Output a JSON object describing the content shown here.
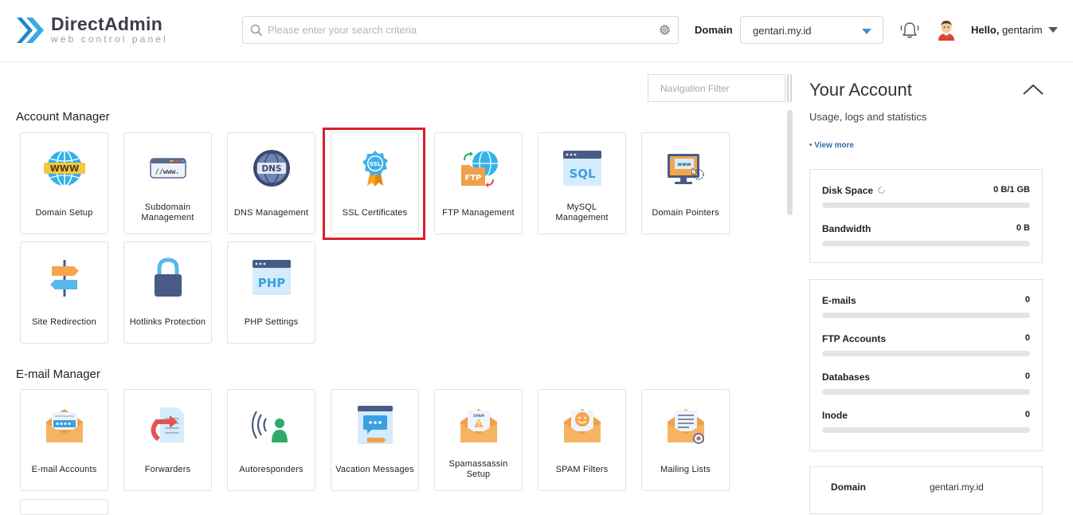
{
  "header": {
    "brand_title": "DirectAdmin",
    "brand_subtitle": "web control panel",
    "search_placeholder": "Please enter your search criteria",
    "domain_label": "Domain",
    "domain_value": "gentari.my.id",
    "greeting": "Hello,",
    "username": "gentarim"
  },
  "nav_filter": {
    "placeholder": "Navigation Filter"
  },
  "sections": [
    {
      "title": "Account Manager",
      "items": [
        {
          "label": "Domain Setup",
          "icon": "www-globe-icon"
        },
        {
          "label": "Subdomain Management",
          "icon": "subdomain-icon"
        },
        {
          "label": "DNS Management",
          "icon": "dns-globe-icon"
        },
        {
          "label": "SSL Certificates",
          "icon": "ssl-badge-icon"
        },
        {
          "label": "FTP Management",
          "icon": "ftp-folder-icon"
        },
        {
          "label": "MySQL Management",
          "icon": "sql-window-icon"
        },
        {
          "label": "Domain Pointers",
          "icon": "domain-pointer-monitor-icon"
        },
        {
          "label": "Site Redirection",
          "icon": "signpost-icon"
        },
        {
          "label": "Hotlinks Protection",
          "icon": "padlock-icon"
        },
        {
          "label": "PHP Settings",
          "icon": "php-window-icon"
        }
      ]
    },
    {
      "title": "E-mail Manager",
      "items": [
        {
          "label": "E-mail Accounts",
          "icon": "envelope-password-icon"
        },
        {
          "label": "Forwarders",
          "icon": "forward-document-icon"
        },
        {
          "label": "Autoresponders",
          "icon": "autoresponder-person-icon"
        },
        {
          "label": "Vacation Messages",
          "icon": "vacation-chat-icon"
        },
        {
          "label": "Spamassassin Setup",
          "icon": "spam-envelope-icon"
        },
        {
          "label": "SPAM Filters",
          "icon": "spam-filter-smiley-icon"
        },
        {
          "label": "Mailing Lists",
          "icon": "mailing-list-icon"
        }
      ]
    }
  ],
  "account": {
    "title": "Your Account",
    "subtitle": "Usage, logs and statistics",
    "view_more": "• View more",
    "usage": [
      {
        "name": "Disk Space",
        "value": "0 B/1 GB",
        "fraction": 0
      },
      {
        "name": "Bandwidth",
        "value": "0 B",
        "fraction": 0
      }
    ],
    "counts": [
      {
        "name": "E-mails",
        "value": "0",
        "fraction": 0
      },
      {
        "name": "FTP Accounts",
        "value": "0",
        "fraction": 0
      },
      {
        "name": "Databases",
        "value": "0",
        "fraction": 0
      },
      {
        "name": "Inode",
        "value": "0",
        "fraction": 0
      }
    ],
    "info": [
      {
        "key": "Domain",
        "value": "gentari.my.id"
      }
    ]
  },
  "colors": {
    "accent": "#3a93d6",
    "highlight_border": "#d9202a",
    "brand_blue": "#2d9cdb"
  }
}
